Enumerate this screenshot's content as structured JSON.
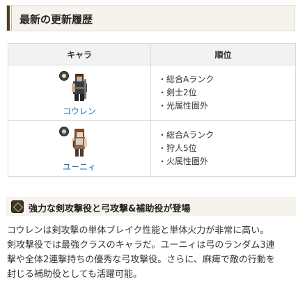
{
  "section": {
    "title": "最新の更新履歴"
  },
  "table": {
    "headers": [
      "キャラ",
      "順位"
    ],
    "rows": [
      {
        "name": "コウレン",
        "element_color": "#e8e2a0",
        "info": [
          "・総合Aランク",
          "・剣士2位",
          "・光属性圏外"
        ]
      },
      {
        "name": "ユーニィ",
        "element_color": "#d8d0c8",
        "info": [
          "・総合Aランク",
          "・狩人5位",
          "・火属性圏外"
        ]
      }
    ]
  },
  "highlight": {
    "title": "強力な剣攻撃役と弓攻撃&補助役が登場",
    "lines": [
      "コウレンは剣攻撃の単体ブレイク性能と単体火力が非常に高い。",
      "剣攻撃役では最強クラスのキャラだ。ユーニィは弓のランダム3連",
      "撃や全体2連撃持ちの優秀な弓攻撃役。さらに、麻痺で敵の行動を",
      "封じる補助役としても活躍可能。"
    ]
  }
}
